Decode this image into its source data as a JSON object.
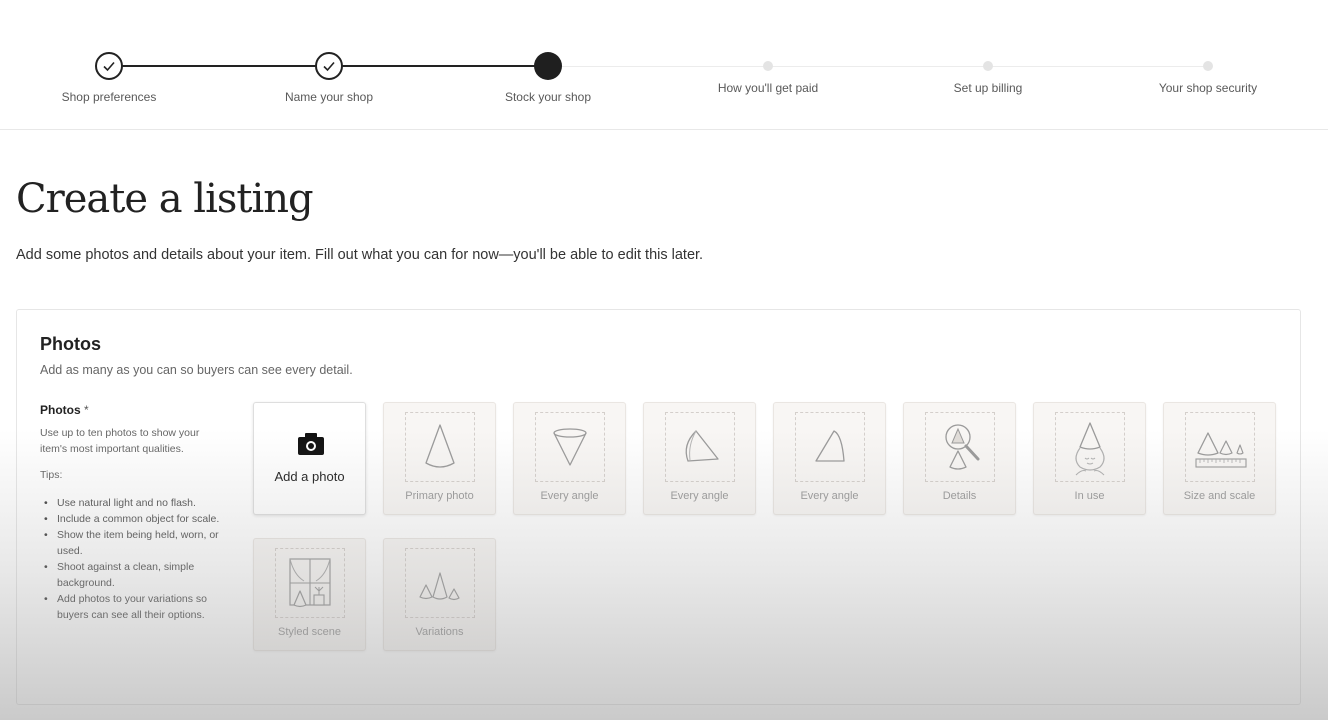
{
  "stepper": {
    "steps": [
      {
        "label": "Shop preferences",
        "state": "complete"
      },
      {
        "label": "Name your shop",
        "state": "complete"
      },
      {
        "label": "Stock your shop",
        "state": "current"
      },
      {
        "label": "How you'll get paid",
        "state": "pending"
      },
      {
        "label": "Set up billing",
        "state": "pending"
      },
      {
        "label": "Your shop security",
        "state": "pending"
      }
    ]
  },
  "header": {
    "title": "Create a listing",
    "subtitle": "Add some photos and details about your item. Fill out what you can for now—you'll be able to edit this later."
  },
  "photos_section": {
    "title": "Photos",
    "subtitle": "Add as many as you can so buyers can see every detail.",
    "field_label": "Photos",
    "required_marker": "*",
    "help": "Use up to ten photos to show your item's most important qualities.",
    "tips_label": "Tips:",
    "tips": [
      "Use natural light and no flash.",
      "Include a common object for scale.",
      "Show the item being held, worn, or used.",
      "Shoot against a clean, simple background.",
      "Add photos to your variations so buyers can see all their options."
    ],
    "add_photo_label": "Add a photo",
    "add_photo_icon": "camera-icon",
    "slots": [
      {
        "label": "Primary photo",
        "icon": "cone-icon"
      },
      {
        "label": "Every angle",
        "icon": "cone-inverted-icon"
      },
      {
        "label": "Every angle",
        "icon": "cone-tilted-icon"
      },
      {
        "label": "Every angle",
        "icon": "cone-side-icon"
      },
      {
        "label": "Details",
        "icon": "magnifier-cone-icon"
      },
      {
        "label": "In use",
        "icon": "cone-hat-person-icon"
      },
      {
        "label": "Size and scale",
        "icon": "cones-ruler-icon"
      },
      {
        "label": "Styled scene",
        "icon": "window-scene-icon"
      },
      {
        "label": "Variations",
        "icon": "cone-variations-icon"
      }
    ]
  }
}
